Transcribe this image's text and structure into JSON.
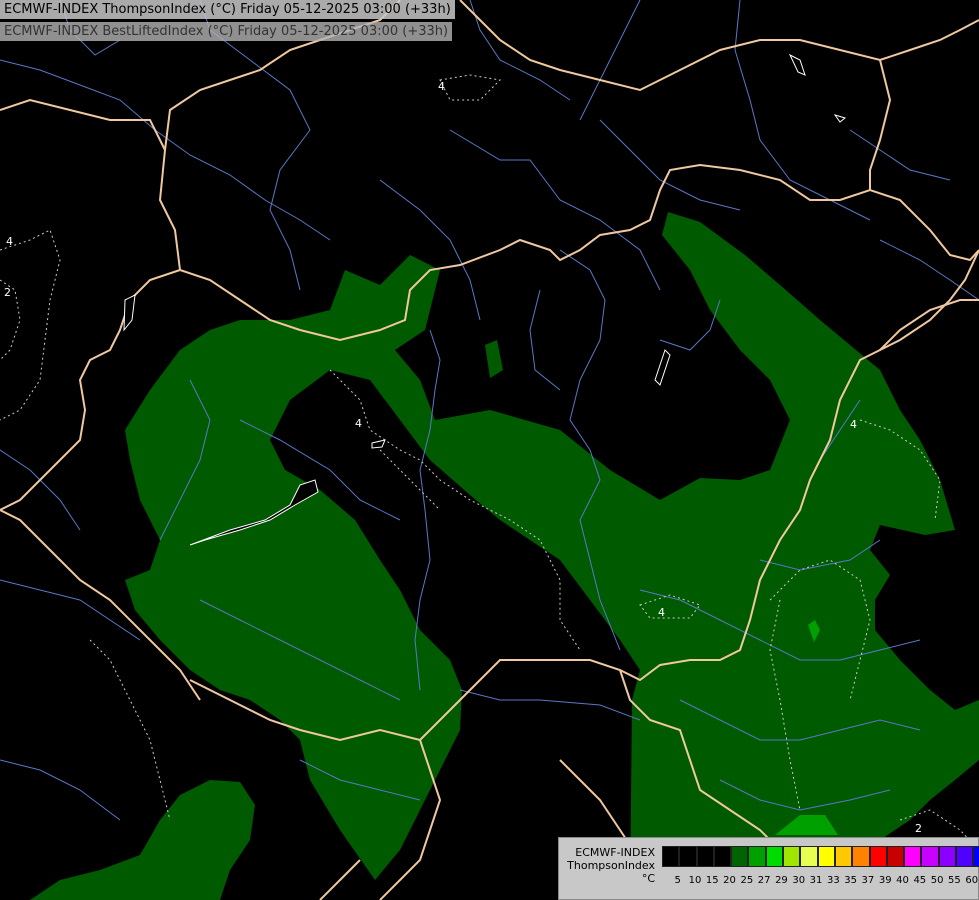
{
  "header": {
    "line1": "ECMWF-INDEX ThompsonIndex (°C) Friday 05-12-2025 03:00 (+33h)",
    "line2": "ECMWF-INDEX BestLiftedIndex (°C) Friday 05-12-2025 03:00 (+33h)"
  },
  "contour_labels": [
    "4",
    "4",
    "2",
    "4",
    "4",
    "4",
    "2"
  ],
  "legend": {
    "title_lines": [
      "ECMWF-INDEX",
      "ThompsonIndex",
      "°C"
    ],
    "colors": [
      "#000000",
      "#000000",
      "#000000",
      "#000000",
      "#006400",
      "#00a000",
      "#00dc00",
      "#a0e600",
      "#e6ff50",
      "#ffff00",
      "#ffc800",
      "#ff8200",
      "#ff0000",
      "#c80000",
      "#ff00ff",
      "#c800ff",
      "#8c00ff",
      "#5000ff",
      "#0000ff"
    ],
    "ticks": [
      "5",
      "10",
      "15",
      "20",
      "25",
      "27",
      "29",
      "30",
      "31",
      "33",
      "35",
      "37",
      "39",
      "40",
      "45",
      "50",
      "55",
      "60"
    ]
  },
  "colors": {
    "fill_green": "#005a00",
    "fill_bright": "#00a000",
    "borders": "#f0c8a0",
    "rivers": "#5a78c8",
    "lakes": "#ffffff"
  }
}
